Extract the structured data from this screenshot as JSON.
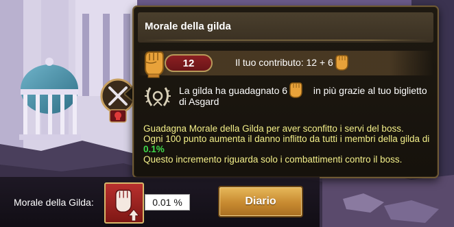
{
  "tooltip": {
    "title": "Morale della gilda",
    "contribution": {
      "count": "12",
      "label": "Il tuo contributo: 12 + 6"
    },
    "asgard": {
      "line1_a": "La gilda ha guadagnato 6",
      "line1_b": "in più grazie al tuo biglietto",
      "line2": "di Asgard"
    },
    "description": {
      "line1": "Guadagna Morale della Gilda per aver sconfitto i servi del boss.",
      "line2": "Ogni 100 punto aumenta il danno inflitto da tutti i membri della gilda di",
      "percent": "0.1%",
      "line3": "Questo incremento riguarda solo i combattimenti contro il boss."
    }
  },
  "bottom": {
    "morale_label": "Morale della Gilda:",
    "morale_value": "0.01 %",
    "diario_button": "Diario"
  },
  "icons": {
    "fist": "raised-fist-icon",
    "asgard": "asgard-laurel-icon",
    "morale": "fist-up-arrow-icon",
    "battle": "crossed-swords-icon",
    "skull": "skull-icon"
  },
  "colors": {
    "title": "#ffffff",
    "description": "#f4f08a",
    "percent": "#3fd94a",
    "count_pill": "#8c1f22",
    "button": "#c78a30",
    "panel_border": "#6f5a34"
  }
}
